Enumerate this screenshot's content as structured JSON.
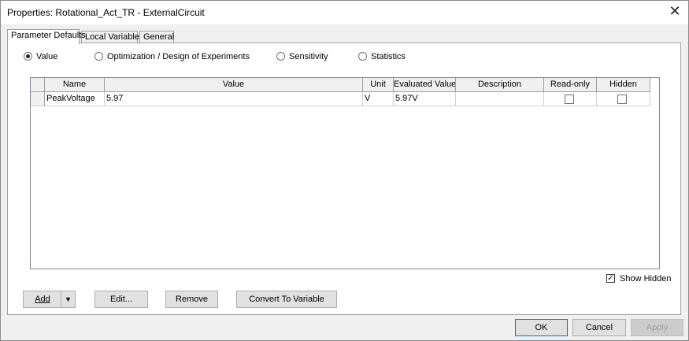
{
  "window": {
    "title": "Properties: Rotational_Act_TR - ExternalCircuit",
    "close_glyph": "✕"
  },
  "tabs": [
    {
      "label": "Parameter Defaults"
    },
    {
      "label": "Local Variables"
    },
    {
      "label": "General"
    }
  ],
  "radios": [
    {
      "label": "Value",
      "selected": true
    },
    {
      "label": "Optimization / Design of Experiments",
      "selected": false
    },
    {
      "label": "Sensitivity",
      "selected": false
    },
    {
      "label": "Statistics",
      "selected": false
    }
  ],
  "table": {
    "columns": [
      "Name",
      "Value",
      "Unit",
      "Evaluated Value",
      "Description",
      "Read-only",
      "Hidden"
    ],
    "rows": [
      {
        "name": "PeakVoltage",
        "value": "5.97",
        "unit": "V",
        "evaluated": "5.97V",
        "description": "",
        "readonly": false,
        "hidden": false
      }
    ]
  },
  "show_hidden": {
    "label": "Show Hidden",
    "checked": true,
    "glyph": "✓"
  },
  "buttons": {
    "add": "Add",
    "edit": "Edit...",
    "remove": "Remove",
    "convert": "Convert To Variable",
    "ok": "OK",
    "cancel": "Cancel",
    "apply": "Apply",
    "dropdown_glyph": "▼"
  }
}
